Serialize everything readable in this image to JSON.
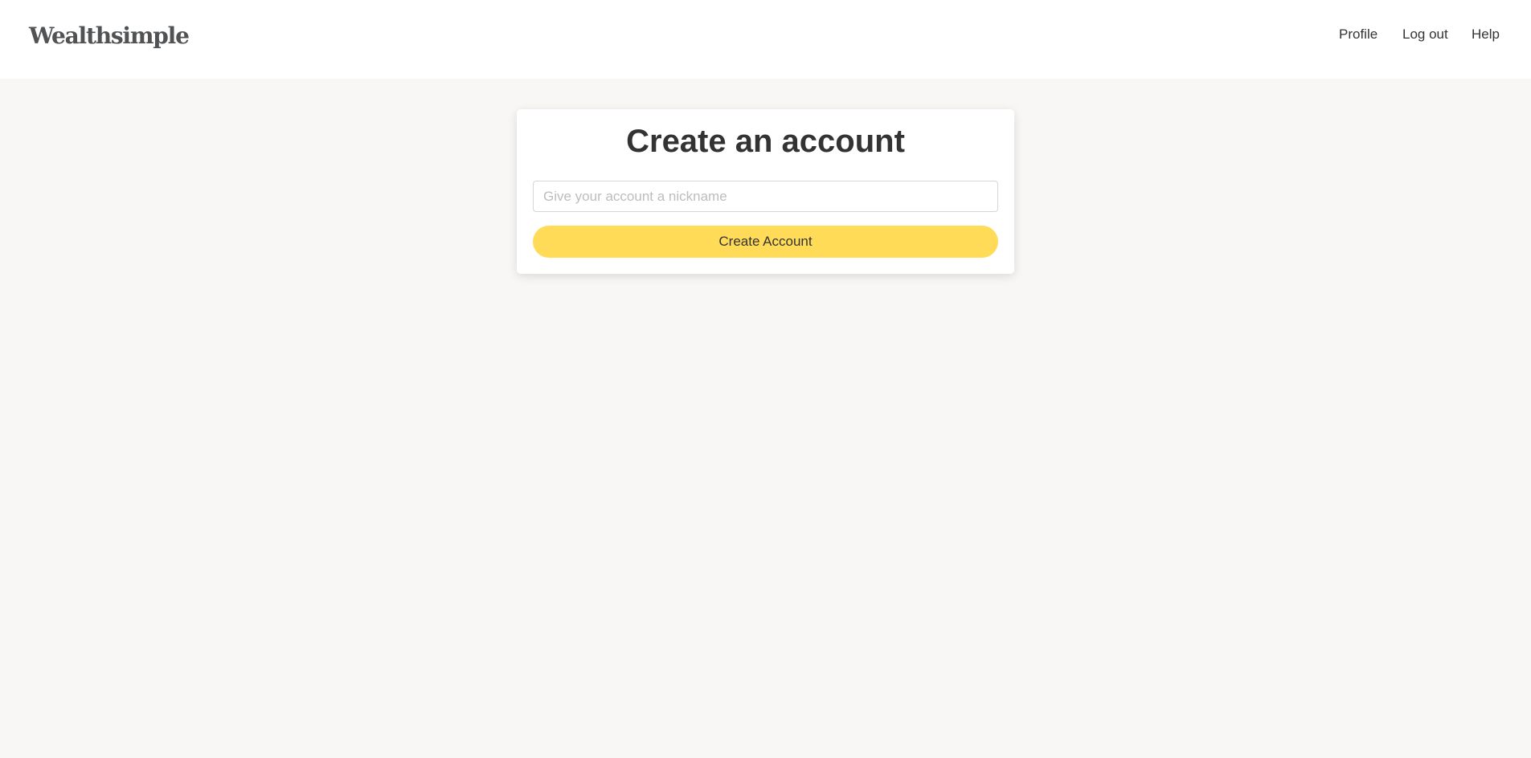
{
  "header": {
    "logo": "Wealthsimple",
    "nav": [
      "Profile",
      "Log out",
      "Help"
    ]
  },
  "card": {
    "title": "Create an account",
    "nickname_placeholder": "Give your account a nickname",
    "nickname_value": "",
    "submit_label": "Create Account"
  },
  "colors": {
    "accent": "#ffdb57",
    "background": "#f8f7f5"
  }
}
